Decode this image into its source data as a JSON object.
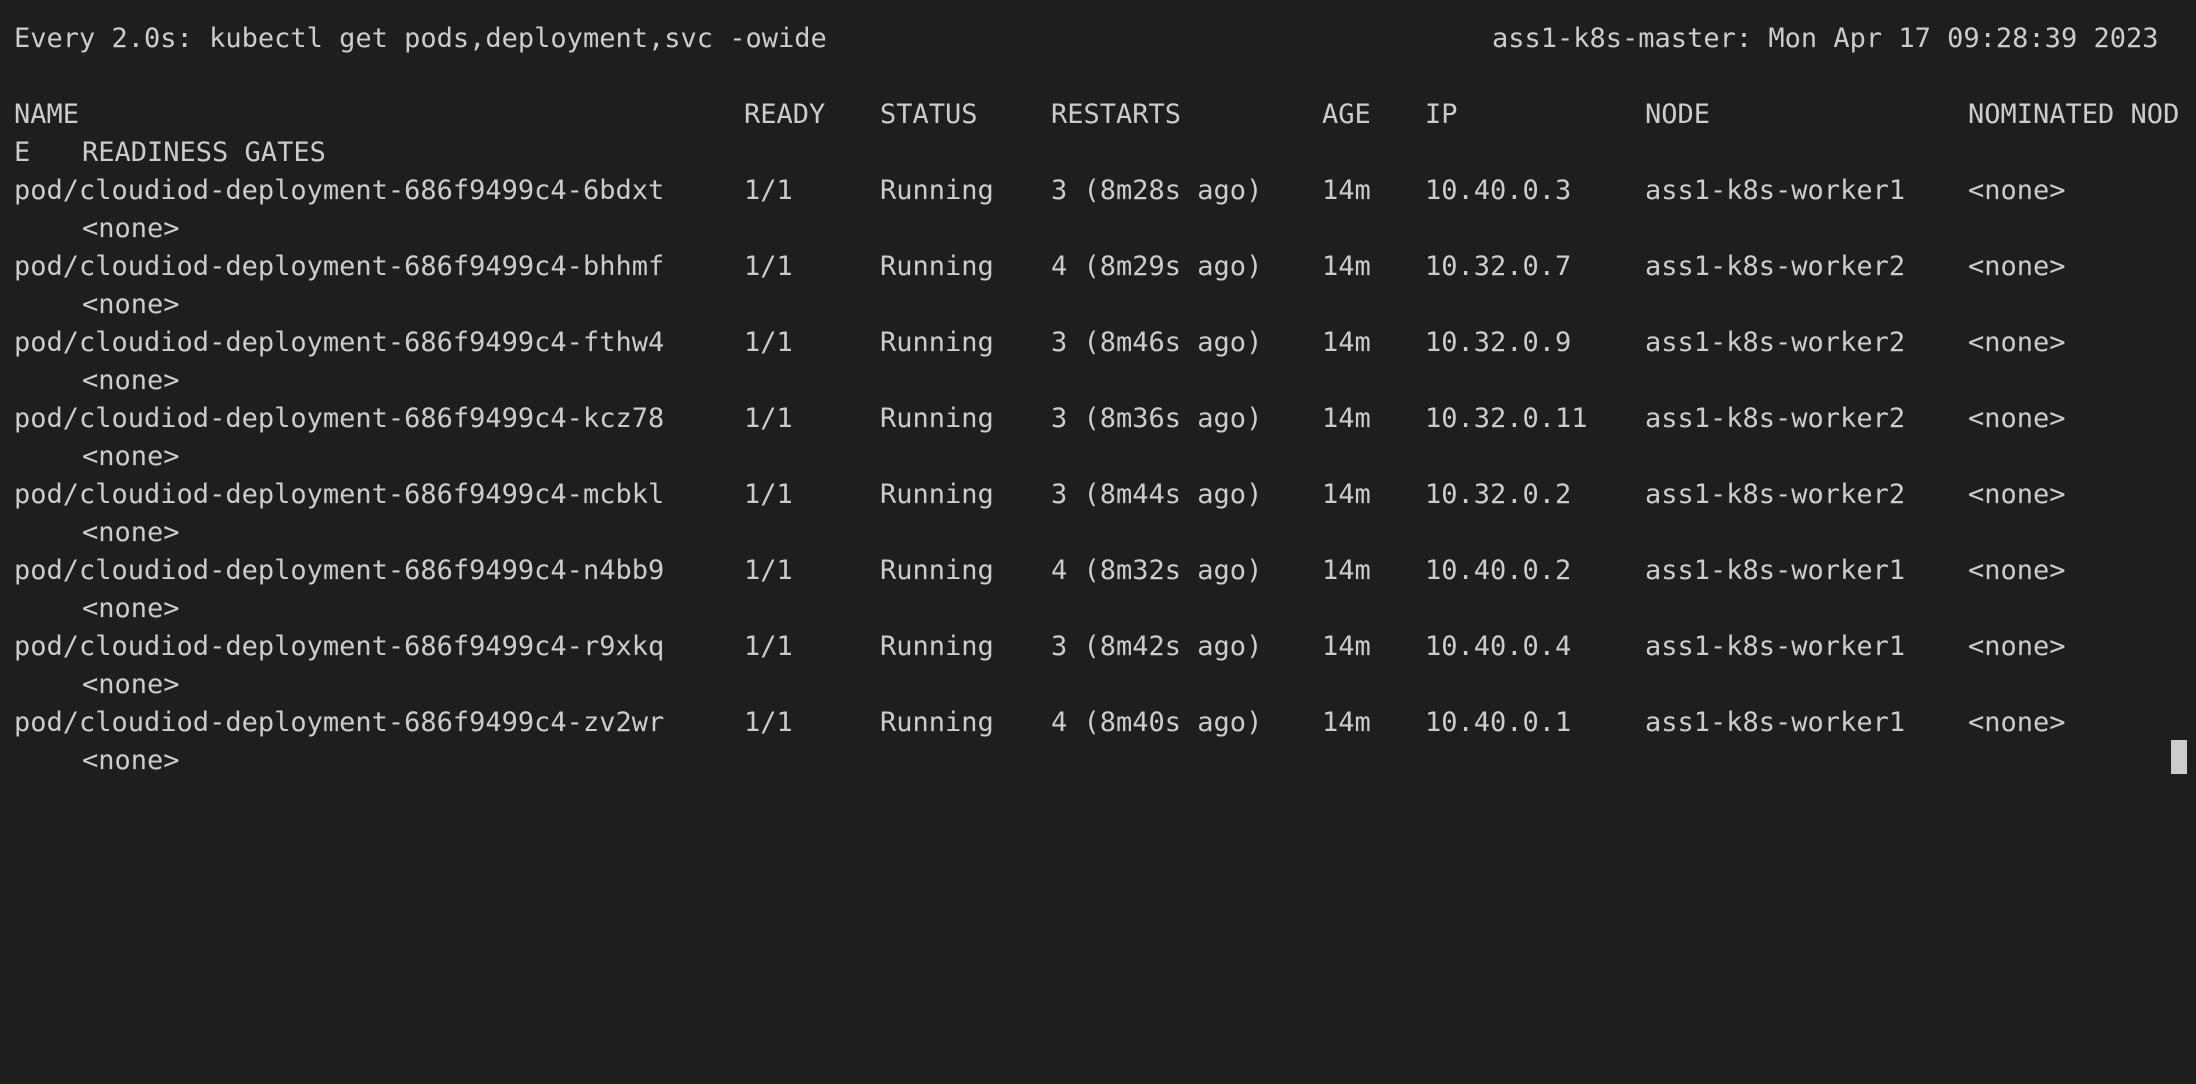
{
  "watch": {
    "command": "Every 2.0s: kubectl get pods,deployment,svc -owide",
    "status": "ass1-k8s-master: Mon Apr 17 09:28:39 2023"
  },
  "table": {
    "headers": {
      "name": "NAME",
      "ready": "READY",
      "status": "STATUS",
      "restarts": "RESTARTS",
      "age": "AGE",
      "ip": "IP",
      "node": "NODE",
      "nominated": "NOMINATED NOD",
      "wrap_e": "E",
      "readiness": "READINESS GATES"
    },
    "rows": [
      {
        "name": "pod/cloudiod-deployment-686f9499c4-6bdxt",
        "ready": "1/1",
        "status": "Running",
        "restarts": "3 (8m28s ago)",
        "age": "14m",
        "ip": "10.40.0.3",
        "node": "ass1-k8s-worker1",
        "nominated": "<none>",
        "readiness": "<none>"
      },
      {
        "name": "pod/cloudiod-deployment-686f9499c4-bhhmf",
        "ready": "1/1",
        "status": "Running",
        "restarts": "4 (8m29s ago)",
        "age": "14m",
        "ip": "10.32.0.7",
        "node": "ass1-k8s-worker2",
        "nominated": "<none>",
        "readiness": "<none>"
      },
      {
        "name": "pod/cloudiod-deployment-686f9499c4-fthw4",
        "ready": "1/1",
        "status": "Running",
        "restarts": "3 (8m46s ago)",
        "age": "14m",
        "ip": "10.32.0.9",
        "node": "ass1-k8s-worker2",
        "nominated": "<none>",
        "readiness": "<none>"
      },
      {
        "name": "pod/cloudiod-deployment-686f9499c4-kcz78",
        "ready": "1/1",
        "status": "Running",
        "restarts": "3 (8m36s ago)",
        "age": "14m",
        "ip": "10.32.0.11",
        "node": "ass1-k8s-worker2",
        "nominated": "<none>",
        "readiness": "<none>"
      },
      {
        "name": "pod/cloudiod-deployment-686f9499c4-mcbkl",
        "ready": "1/1",
        "status": "Running",
        "restarts": "3 (8m44s ago)",
        "age": "14m",
        "ip": "10.32.0.2",
        "node": "ass1-k8s-worker2",
        "nominated": "<none>",
        "readiness": "<none>"
      },
      {
        "name": "pod/cloudiod-deployment-686f9499c4-n4bb9",
        "ready": "1/1",
        "status": "Running",
        "restarts": "4 (8m32s ago)",
        "age": "14m",
        "ip": "10.40.0.2",
        "node": "ass1-k8s-worker1",
        "nominated": "<none>",
        "readiness": "<none>"
      },
      {
        "name": "pod/cloudiod-deployment-686f9499c4-r9xkq",
        "ready": "1/1",
        "status": "Running",
        "restarts": "3 (8m42s ago)",
        "age": "14m",
        "ip": "10.40.0.4",
        "node": "ass1-k8s-worker1",
        "nominated": "<none>",
        "readiness": "<none>"
      },
      {
        "name": "pod/cloudiod-deployment-686f9499c4-zv2wr",
        "ready": "1/1",
        "status": "Running",
        "restarts": "4 (8m40s ago)",
        "age": "14m",
        "ip": "10.40.0.1",
        "node": "ass1-k8s-worker1",
        "nominated": "<none>",
        "readiness": "<none>"
      }
    ]
  }
}
